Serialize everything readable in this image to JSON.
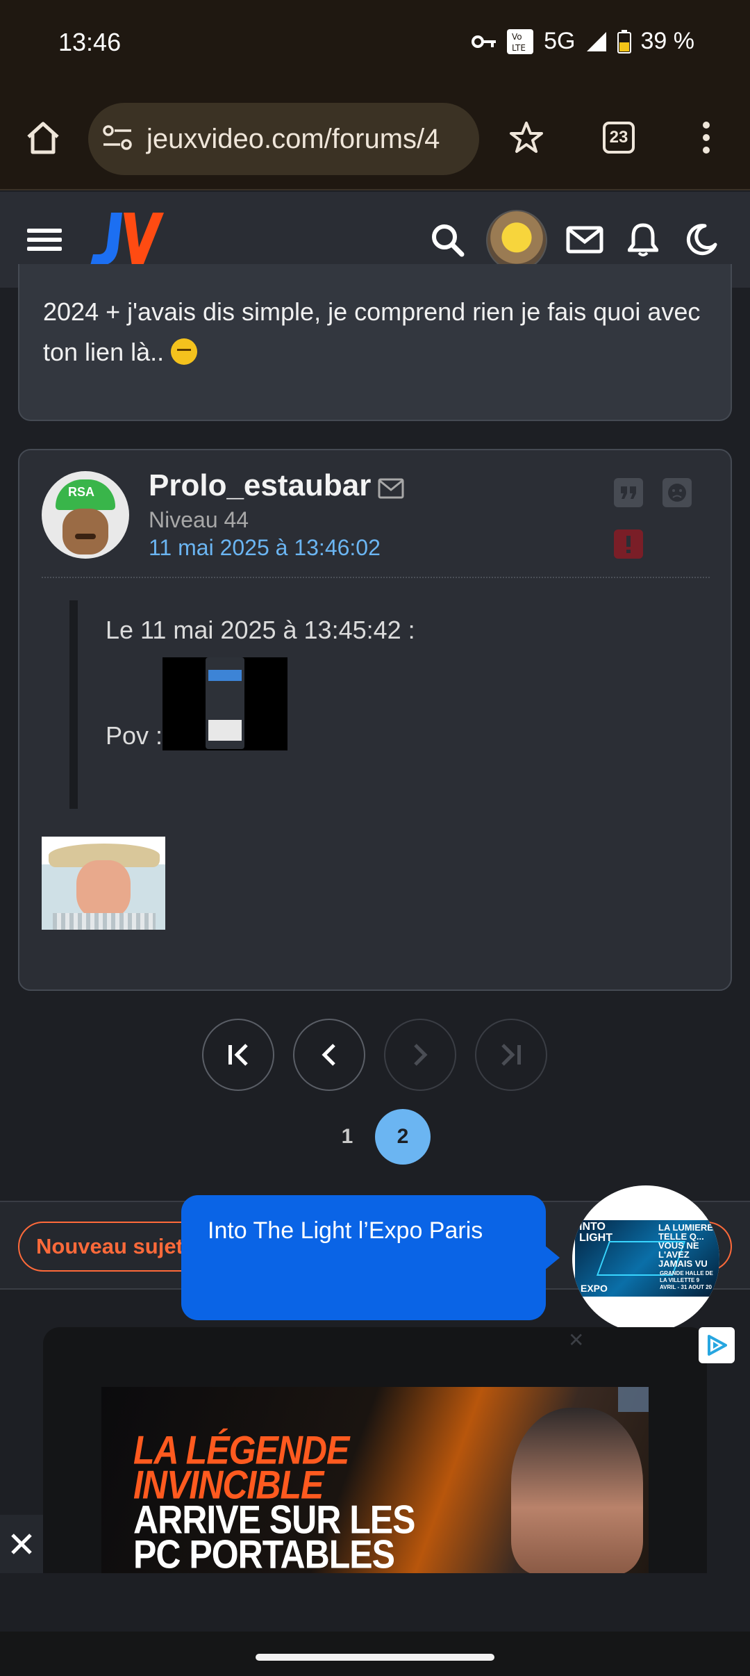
{
  "status_bar": {
    "time": "13:46",
    "network": "5G",
    "battery": "39 %"
  },
  "browser": {
    "url": "jeuxvideo.com/forums/4",
    "tab_count": "23"
  },
  "site": {
    "logo_text": "JV"
  },
  "previous_post": {
    "text": "2024 + j'avais dis simple, je comprend rien je fais quoi avec ton lien là.."
  },
  "post": {
    "author": "Prolo_estaubar",
    "level": "Niveau 44",
    "date": "11 mai 2025 à 13:46:02",
    "avatar_cap_text": "RSA",
    "quote_header": "Le 11 mai 2025 à 13:45:42 :",
    "quote_text": "Pov :"
  },
  "pagination": {
    "pages": [
      "1",
      "2"
    ],
    "current": "2"
  },
  "bottom_bar": {
    "new_topic_label": "Nouveau sujet"
  },
  "ad": {
    "bubble_text": "Into The Light l’Expo Paris",
    "circle_left_text": "INTO\nLIGHT",
    "circle_right_text": "LA LUMIERE TELLE Q... VOUS NE L'AVEZ JAMAIS VU",
    "circle_expo": "EXPO",
    "circle_dates": "GRANDE HALLE DE LA VILLETTE 9 AVRIL - 31 AOUT 20",
    "banner_lines": [
      "LA LÉGENDE",
      "INVINCIBLE",
      "ARRIVE SUR LES",
      "PC PORTABLES"
    ]
  },
  "colors": {
    "accent_blue": "#6bb5f2",
    "new_topic_orange": "#ff6a3a",
    "ad_blue": "#0a64e6",
    "report_red": "#7a1e27"
  }
}
